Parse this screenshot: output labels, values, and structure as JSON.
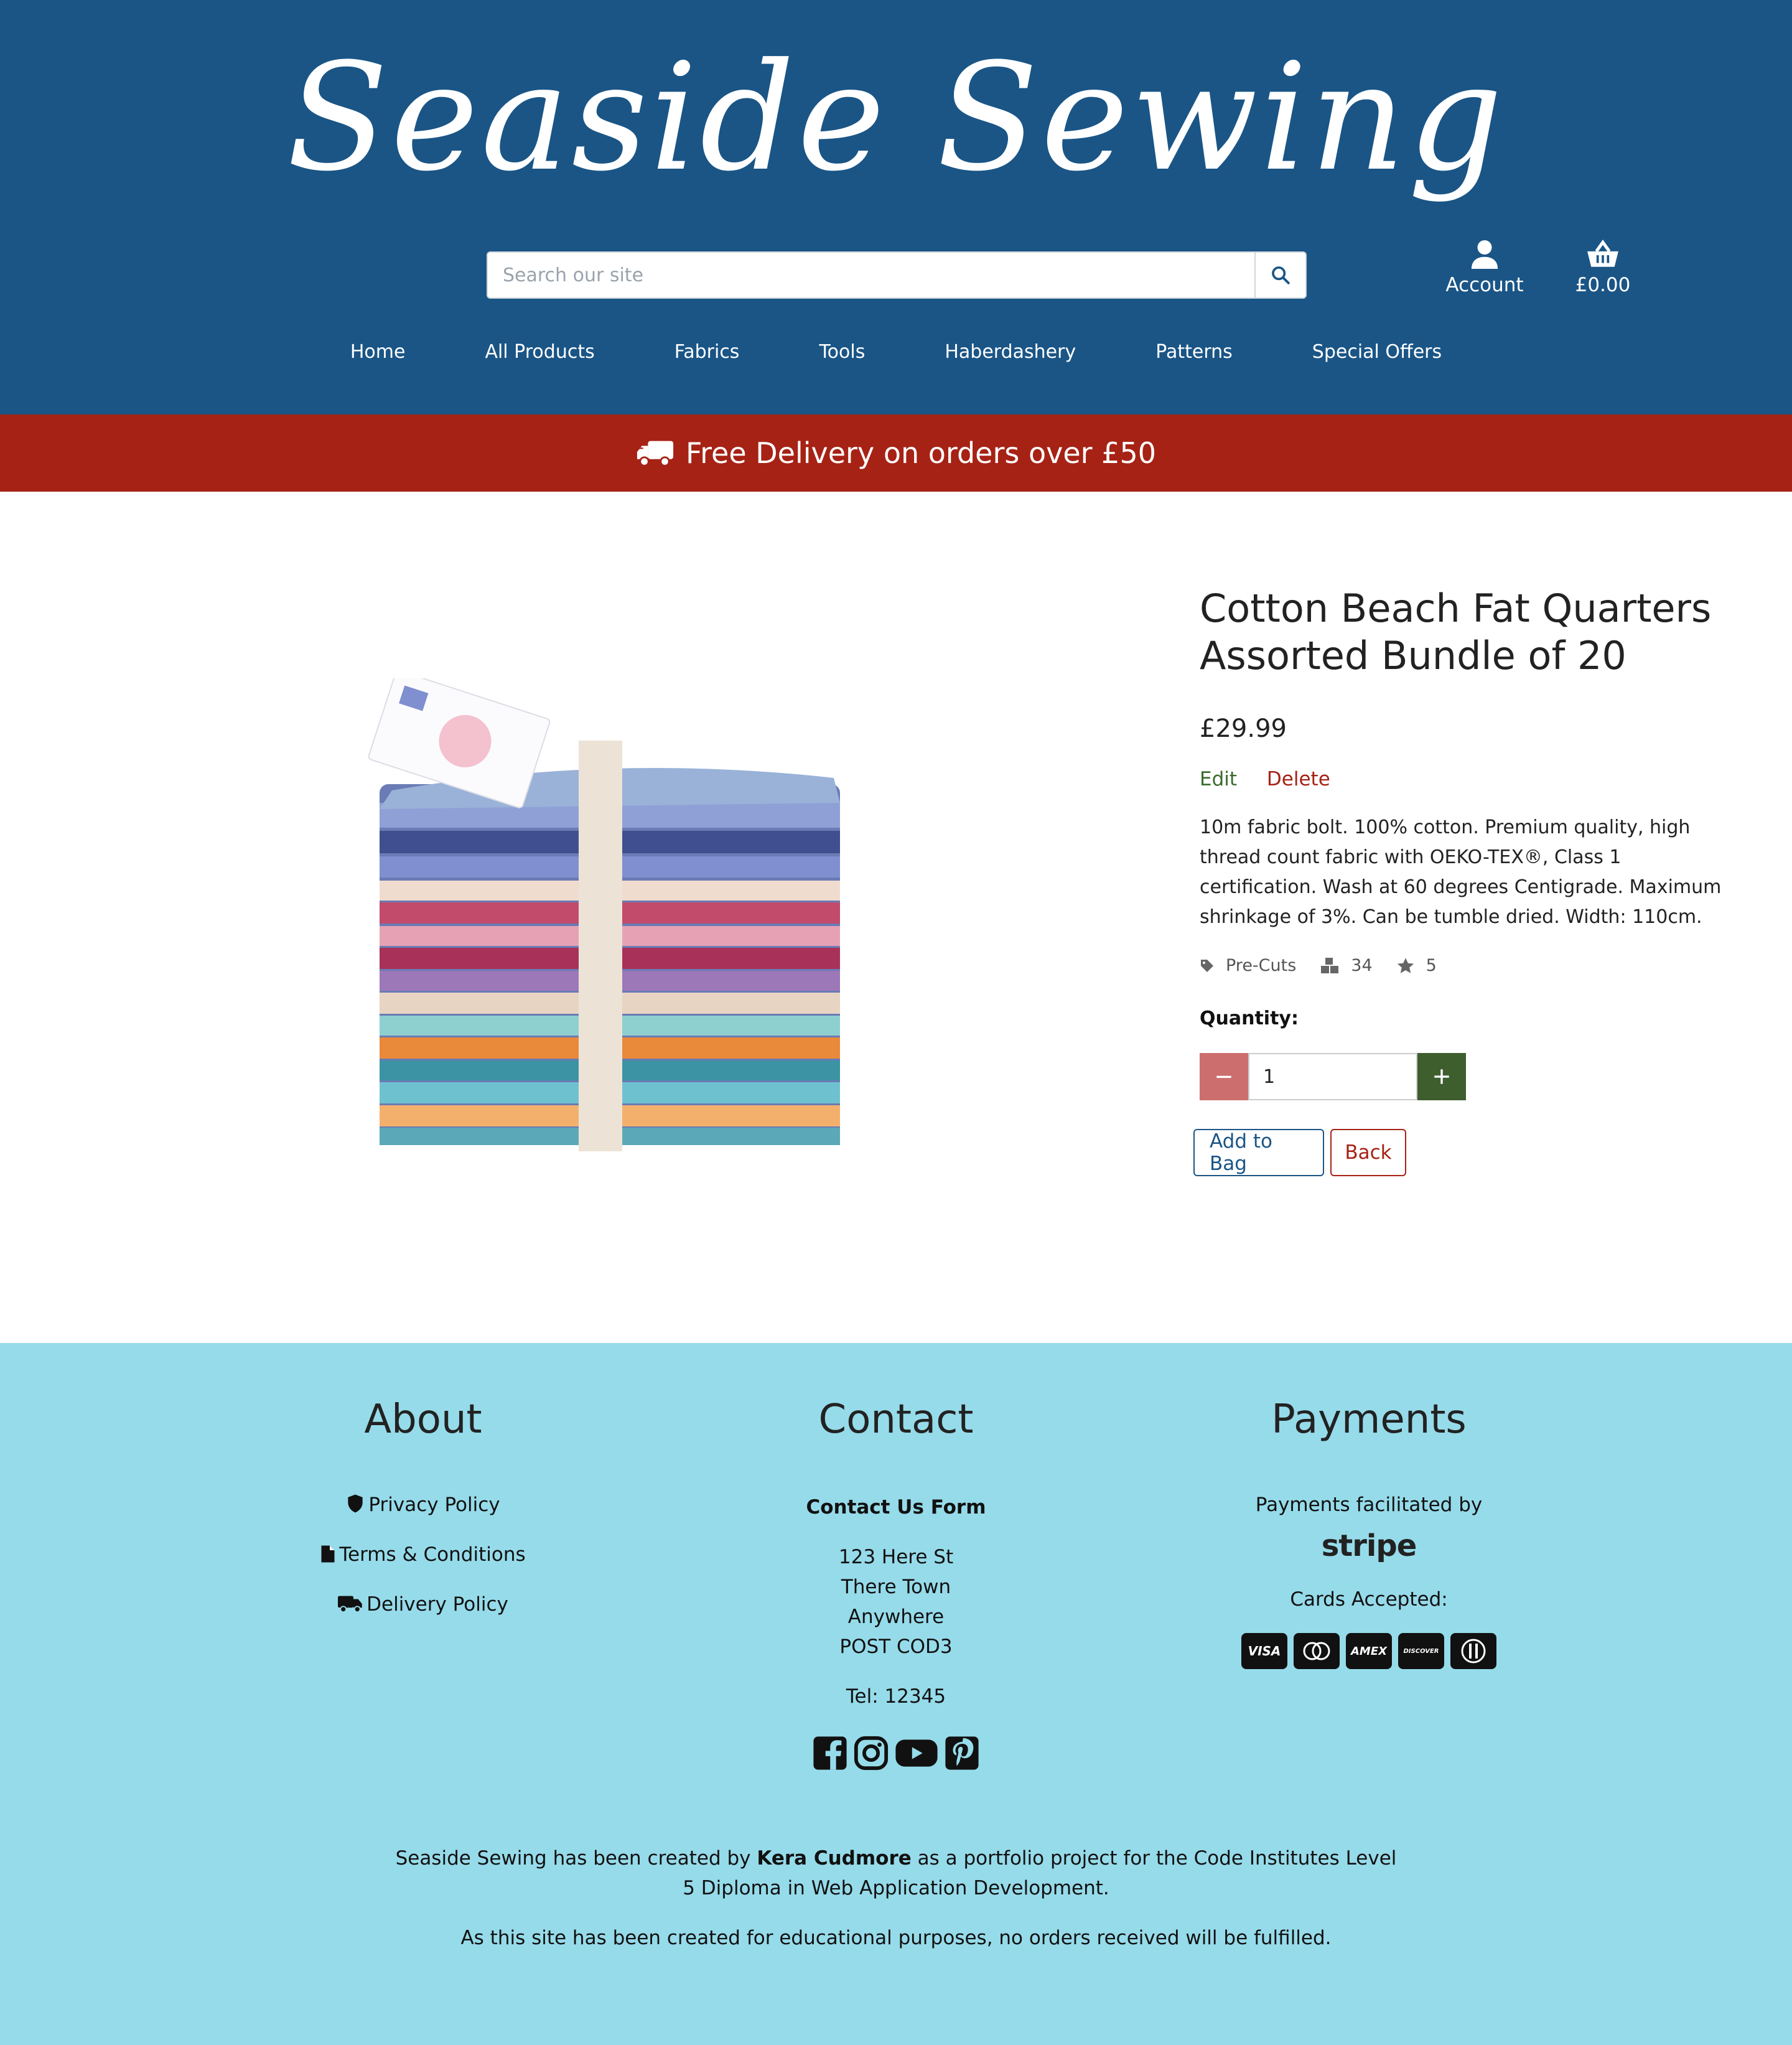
{
  "brand": {
    "logo_text": "Seaside Sewing",
    "primary_color": "#1a5586",
    "accent_color": "#a62215",
    "footer_color": "#96dbea"
  },
  "header": {
    "search_placeholder": "Search our site",
    "account_label": "Account",
    "bag_total": "£0.00"
  },
  "nav": [
    "Home",
    "All Products",
    "Fabrics",
    "Tools",
    "Haberdashery",
    "Patterns",
    "Special Offers"
  ],
  "banner": {
    "text": "Free Delivery on orders over £50",
    "icon": "truck-icon"
  },
  "product": {
    "title": "Cotton Beach Fat Quarters Assorted Bundle of 20",
    "price": "£29.99",
    "edit_label": "Edit",
    "delete_label": "Delete",
    "description": "10m fabric bolt. 100% cotton. Premium quality, high thread count fabric with OEKO-TEX®, Class 1 certification. Wash at 60 degrees Centigrade. Maximum shrinkage of 3%. Can be tumble dried. Width: 110cm.",
    "category": "Pre-Cuts",
    "stock": "34",
    "rating": "5",
    "quantity_label": "Quantity:",
    "quantity_value": "1",
    "add_label": "Add to Bag",
    "back_label": "Back"
  },
  "footer": {
    "about": {
      "heading": "About",
      "links": [
        "Privacy Policy",
        "Terms & Conditions",
        "Delivery Policy"
      ]
    },
    "contact": {
      "heading": "Contact",
      "form_link": "Contact Us Form",
      "address": [
        "123 Here St",
        "There Town",
        "Anywhere",
        "POST COD3"
      ],
      "tel": "Tel: 12345",
      "socials": [
        "facebook-icon",
        "instagram-icon",
        "youtube-icon",
        "pinterest-icon"
      ]
    },
    "payments": {
      "heading": "Payments",
      "facilitated": "Payments facilitated by",
      "stripe": "stripe",
      "cards_label": "Cards Accepted:",
      "cards": [
        "VISA",
        "MC",
        "AMEX",
        "DISCOVER",
        "DINERS"
      ]
    },
    "credit_pre": "Seaside Sewing has been created by ",
    "credit_name": "Kera Cudmore",
    "credit_post": " as a portfolio project for the Code Institutes Level",
    "credit_line2": "5 Diploma in Web Application Development.",
    "disclaimer": "As this site has been created for educational purposes, no orders received will be fulfilled."
  }
}
